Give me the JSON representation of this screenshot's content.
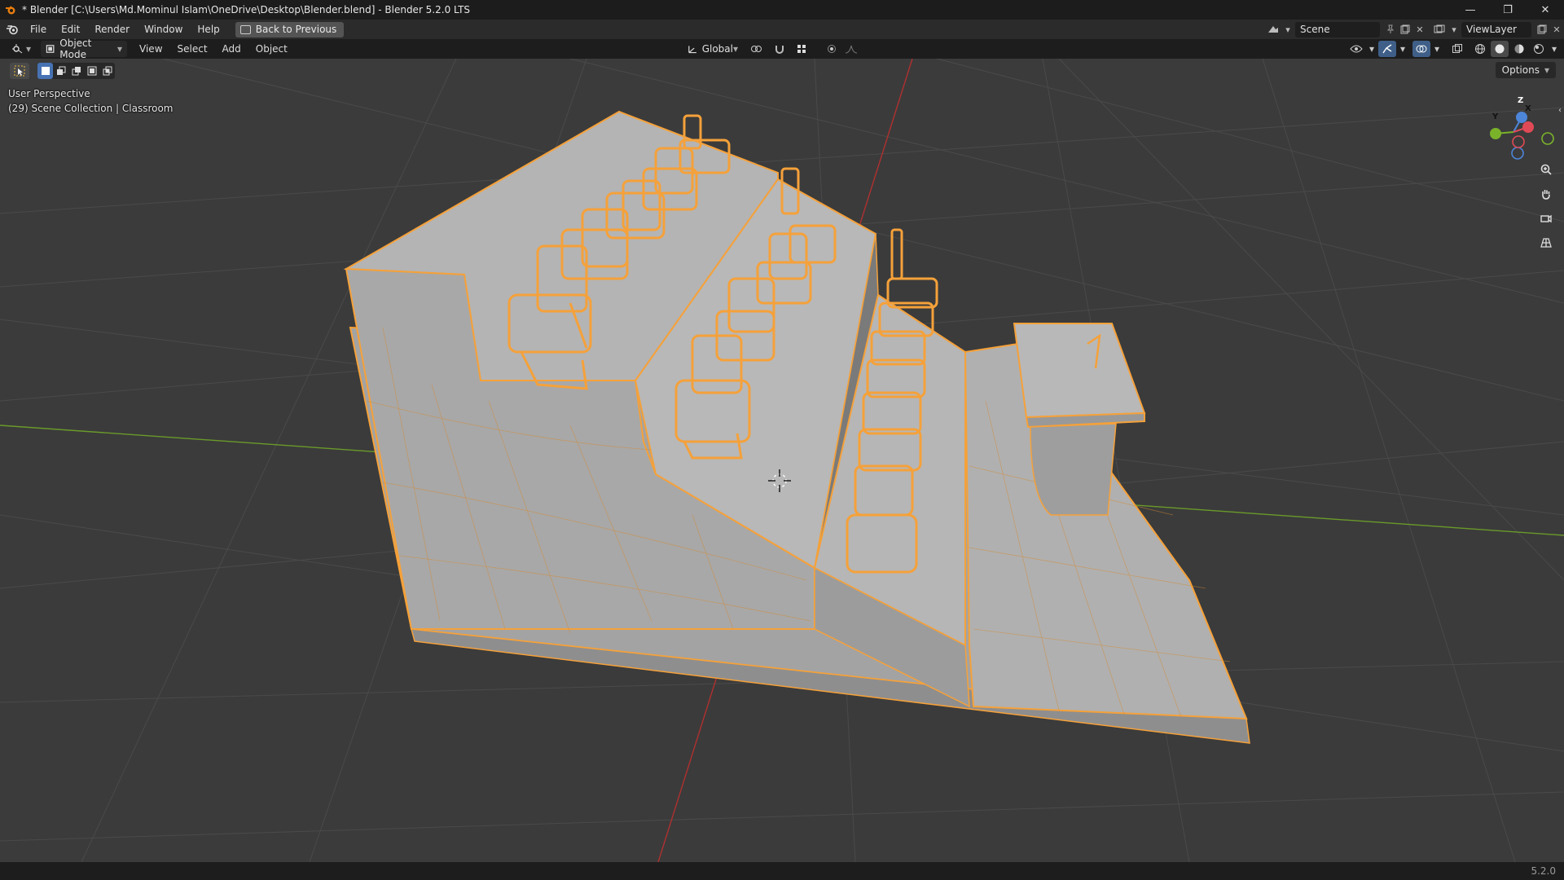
{
  "window": {
    "title": "* Blender [C:\\Users\\Md.Mominul Islam\\OneDrive\\Desktop\\Blender.blend] - Blender 5.2.0 LTS",
    "minimize": "—",
    "maximize": "❐",
    "close": "✕"
  },
  "menubar": {
    "items": [
      "File",
      "Edit",
      "Render",
      "Window",
      "Help"
    ],
    "back_label": "Back to Previous",
    "scene": "Scene",
    "view_layer": "ViewLayer"
  },
  "viewport_header": {
    "mode": "Object Mode",
    "menus": [
      "View",
      "Select",
      "Add",
      "Object"
    ],
    "orientation": "Global"
  },
  "viewport": {
    "perspective": "User Perspective",
    "collection": "(29) Scene Collection | Classroom",
    "options": "Options",
    "axes": {
      "x": "X",
      "y": "Y",
      "z": "Z"
    },
    "colors": {
      "background": "#3b3b3b",
      "grid": "#4a4a4a",
      "x_axis": "#b03030",
      "y_axis": "#6a9a2a",
      "selection": "#f5a13a",
      "mesh": "#a6a6a6"
    }
  },
  "statusbar": {
    "version": "5.2.0"
  }
}
